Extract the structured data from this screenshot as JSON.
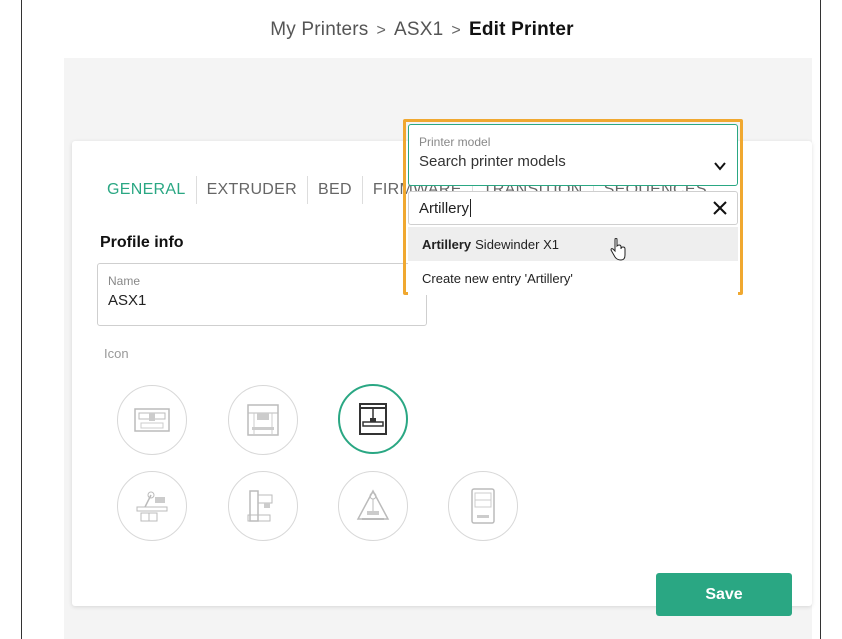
{
  "breadcrumb": {
    "items": [
      "My Printers",
      "ASX1"
    ],
    "separator": ">",
    "current": "Edit Printer"
  },
  "tabs": [
    {
      "label": "GENERAL",
      "active": true
    },
    {
      "label": "EXTRUDER",
      "active": false
    },
    {
      "label": "BED",
      "active": false
    },
    {
      "label": "FIRMWARE",
      "active": false
    },
    {
      "label": "TRANSITION",
      "active": false
    },
    {
      "label": "SEQUENCES",
      "active": false
    }
  ],
  "profile": {
    "section_title": "Profile info",
    "name_label": "Name",
    "name_value": "ASX1",
    "icon_label": "Icon"
  },
  "model": {
    "label": "Printer model",
    "value": "Search printer models",
    "search_value": "Artillery",
    "options": [
      {
        "match": "Artillery",
        "rest": "Sidewinder X1"
      },
      {
        "label": "Create new entry 'Artillery'"
      }
    ]
  },
  "icons": [
    "printer-icon-1",
    "printer-icon-2",
    "printer-icon-3-selected",
    "printer-icon-4",
    "printer-icon-5",
    "printer-icon-6",
    "printer-icon-7",
    "printer-icon-8",
    "printer-icon-9",
    "printer-icon-10"
  ],
  "actions": {
    "save_label": "Save"
  },
  "colors": {
    "accent": "#2aa783",
    "highlight": "#f0a830"
  }
}
